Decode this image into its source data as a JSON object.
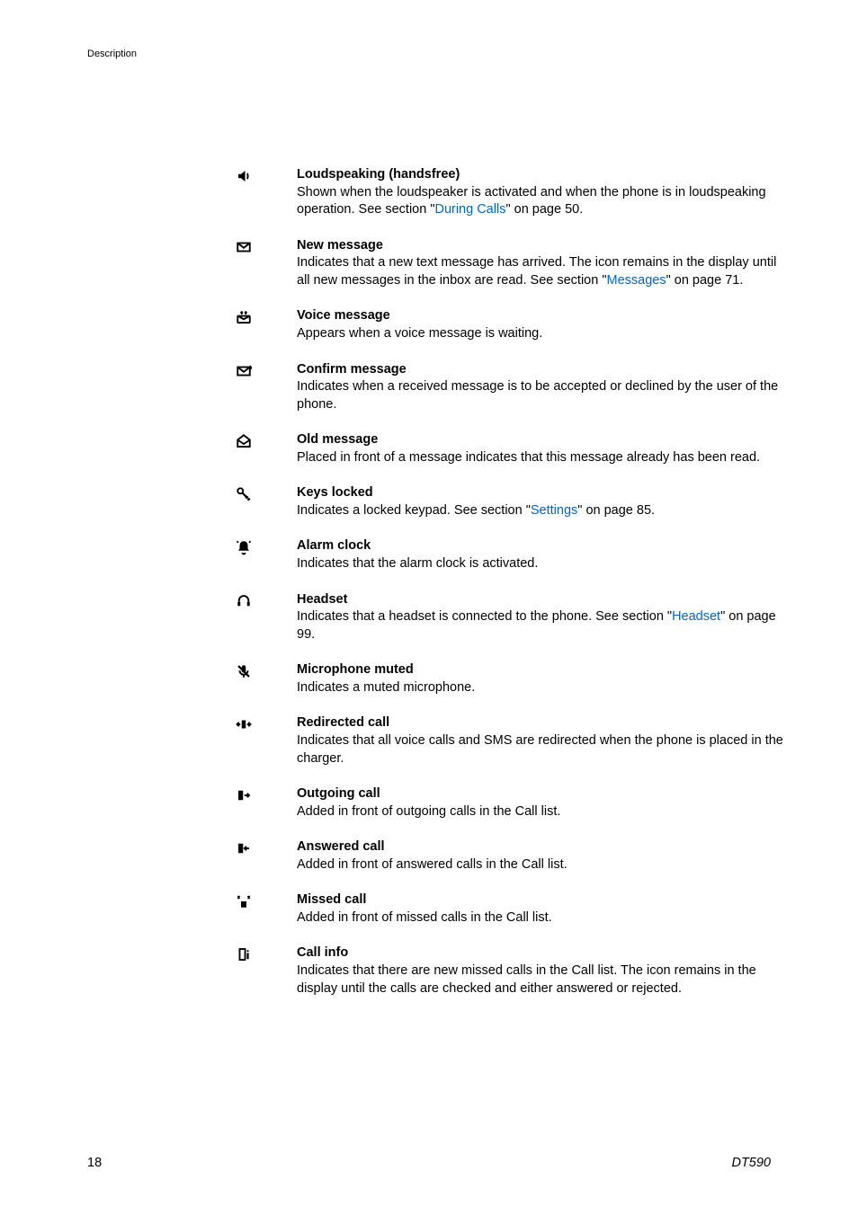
{
  "header": "Description",
  "footer": {
    "page": "18",
    "model": "DT590"
  },
  "items": [
    {
      "id": "loudspeaking",
      "title": "Loudspeaking (handsfree)",
      "segments": [
        {
          "t": "Shown when the loudspeaker is activated and when the phone is in loudspeaking operation. See section \"",
          "link": false
        },
        {
          "t": "During Calls",
          "link": true
        },
        {
          "t": "\" on page 50.",
          "link": false
        }
      ]
    },
    {
      "id": "new-message",
      "title": "New message",
      "segments": [
        {
          "t": "Indicates that a new text message has arrived. The icon remains in the display until all new messages in the inbox are read. See section \"",
          "link": false
        },
        {
          "t": "Messages",
          "link": true
        },
        {
          "t": "\" on page 71.",
          "link": false
        }
      ]
    },
    {
      "id": "voice-message",
      "title": "Voice message",
      "segments": [
        {
          "t": "Appears when a voice message is waiting.",
          "link": false
        }
      ]
    },
    {
      "id": "confirm-message",
      "title": "Confirm message",
      "segments": [
        {
          "t": "Indicates when a received message is to be accepted or declined by the user of the phone.",
          "link": false
        }
      ]
    },
    {
      "id": "old-message",
      "title": "Old message",
      "segments": [
        {
          "t": "Placed in front of a message indicates that this message already has been read.",
          "link": false
        }
      ]
    },
    {
      "id": "keys-locked",
      "title": "Keys locked",
      "segments": [
        {
          "t": "Indicates a locked keypad. See section \"",
          "link": false
        },
        {
          "t": "Settings",
          "link": true
        },
        {
          "t": "\" on page 85.",
          "link": false
        }
      ]
    },
    {
      "id": "alarm-clock",
      "title": "Alarm clock",
      "segments": [
        {
          "t": "Indicates that the alarm clock is activated.",
          "link": false
        }
      ]
    },
    {
      "id": "headset",
      "title": "Headset",
      "segments": [
        {
          "t": "Indicates that a headset is connected to the phone. See section \"",
          "link": false
        },
        {
          "t": "Headset",
          "link": true
        },
        {
          "t": "\" on page 99.",
          "link": false
        }
      ]
    },
    {
      "id": "microphone-muted",
      "title": "Microphone muted",
      "segments": [
        {
          "t": "Indicates a muted microphone.",
          "link": false
        }
      ]
    },
    {
      "id": "redirected-call",
      "title": "Redirected call",
      "segments": [
        {
          "t": "Indicates that all voice calls and SMS are redirected when the phone is placed in the charger.",
          "link": false
        }
      ]
    },
    {
      "id": "outgoing-call",
      "title": "Outgoing call",
      "segments": [
        {
          "t": "Added in front of outgoing calls in the Call list.",
          "link": false
        }
      ]
    },
    {
      "id": "answered-call",
      "title": "Answered call",
      "segments": [
        {
          "t": "Added in front of answered calls in the Call list.",
          "link": false
        }
      ]
    },
    {
      "id": "missed-call",
      "title": "Missed call",
      "segments": [
        {
          "t": "Added in front of missed calls in the Call list.",
          "link": false
        }
      ]
    },
    {
      "id": "call-info",
      "title": "Call info",
      "segments": [
        {
          "t": "Indicates that there are new missed calls in the Call list. The icon remains in the display until the calls are checked and either answered or rejected.",
          "link": false
        }
      ]
    }
  ]
}
